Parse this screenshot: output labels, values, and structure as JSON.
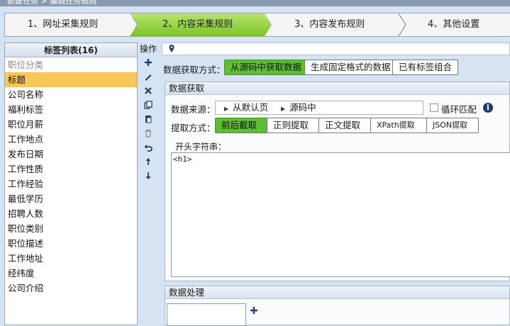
{
  "titlebar": {
    "text": "新建任务 > 编辑任务规则"
  },
  "steps": [
    {
      "label": "1、网址采集规则",
      "active": false
    },
    {
      "label": "2、内容采集规则",
      "active": true
    },
    {
      "label": "3、内容发布规则",
      "active": false
    },
    {
      "label": "4、其他设置",
      "active": false
    }
  ],
  "tag_list": {
    "header": "标签列表(16)",
    "items": [
      {
        "label": "职位分类",
        "type": "group"
      },
      {
        "label": "标题",
        "type": "selected"
      },
      {
        "label": "公司名称",
        "type": "normal"
      },
      {
        "label": "福利标签",
        "type": "normal"
      },
      {
        "label": "职位月薪",
        "type": "normal"
      },
      {
        "label": "工作地点",
        "type": "normal"
      },
      {
        "label": "发布日期",
        "type": "normal"
      },
      {
        "label": "工作性质",
        "type": "normal"
      },
      {
        "label": "工作经验",
        "type": "normal"
      },
      {
        "label": "最低学历",
        "type": "normal"
      },
      {
        "label": "招聘人数",
        "type": "normal"
      },
      {
        "label": "职位类别",
        "type": "normal"
      },
      {
        "label": "职位描述",
        "type": "normal"
      },
      {
        "label": "工作地址",
        "type": "normal"
      },
      {
        "label": "经纬度",
        "type": "normal"
      },
      {
        "label": "公司介绍",
        "type": "normal"
      }
    ]
  },
  "ops": {
    "label": "操作",
    "buttons": [
      "plus-icon",
      "edit-icon",
      "delete-icon",
      "copy-icon",
      "paste-icon",
      "trash-icon",
      "undo-icon",
      "move-up-icon",
      "move-down-icon"
    ]
  },
  "data_mode": {
    "label": "数据获取方式：",
    "options": [
      "从源码中获取数据",
      "生成固定格式的数据",
      "已有标签组合"
    ],
    "selected": 0
  },
  "fetch": {
    "title": "数据获取",
    "source_label": "数据来源：",
    "source_crumbs": [
      "从默认页",
      "源码中"
    ],
    "loop_label": "循环匹配",
    "loop_checked": false,
    "method_label": "提取方式：",
    "methods": [
      "前后截取",
      "正则提取",
      "正文提取",
      "XPath提取",
      "JSON提取"
    ],
    "method_selected": 0,
    "start_label": "开头字符串：",
    "start_value": "<h1>"
  },
  "processing": {
    "title": "数据处理"
  },
  "colors": {
    "accent_green": "#5fbd34",
    "selected_row": "#f8c65a",
    "background": "#d6e3f2"
  }
}
